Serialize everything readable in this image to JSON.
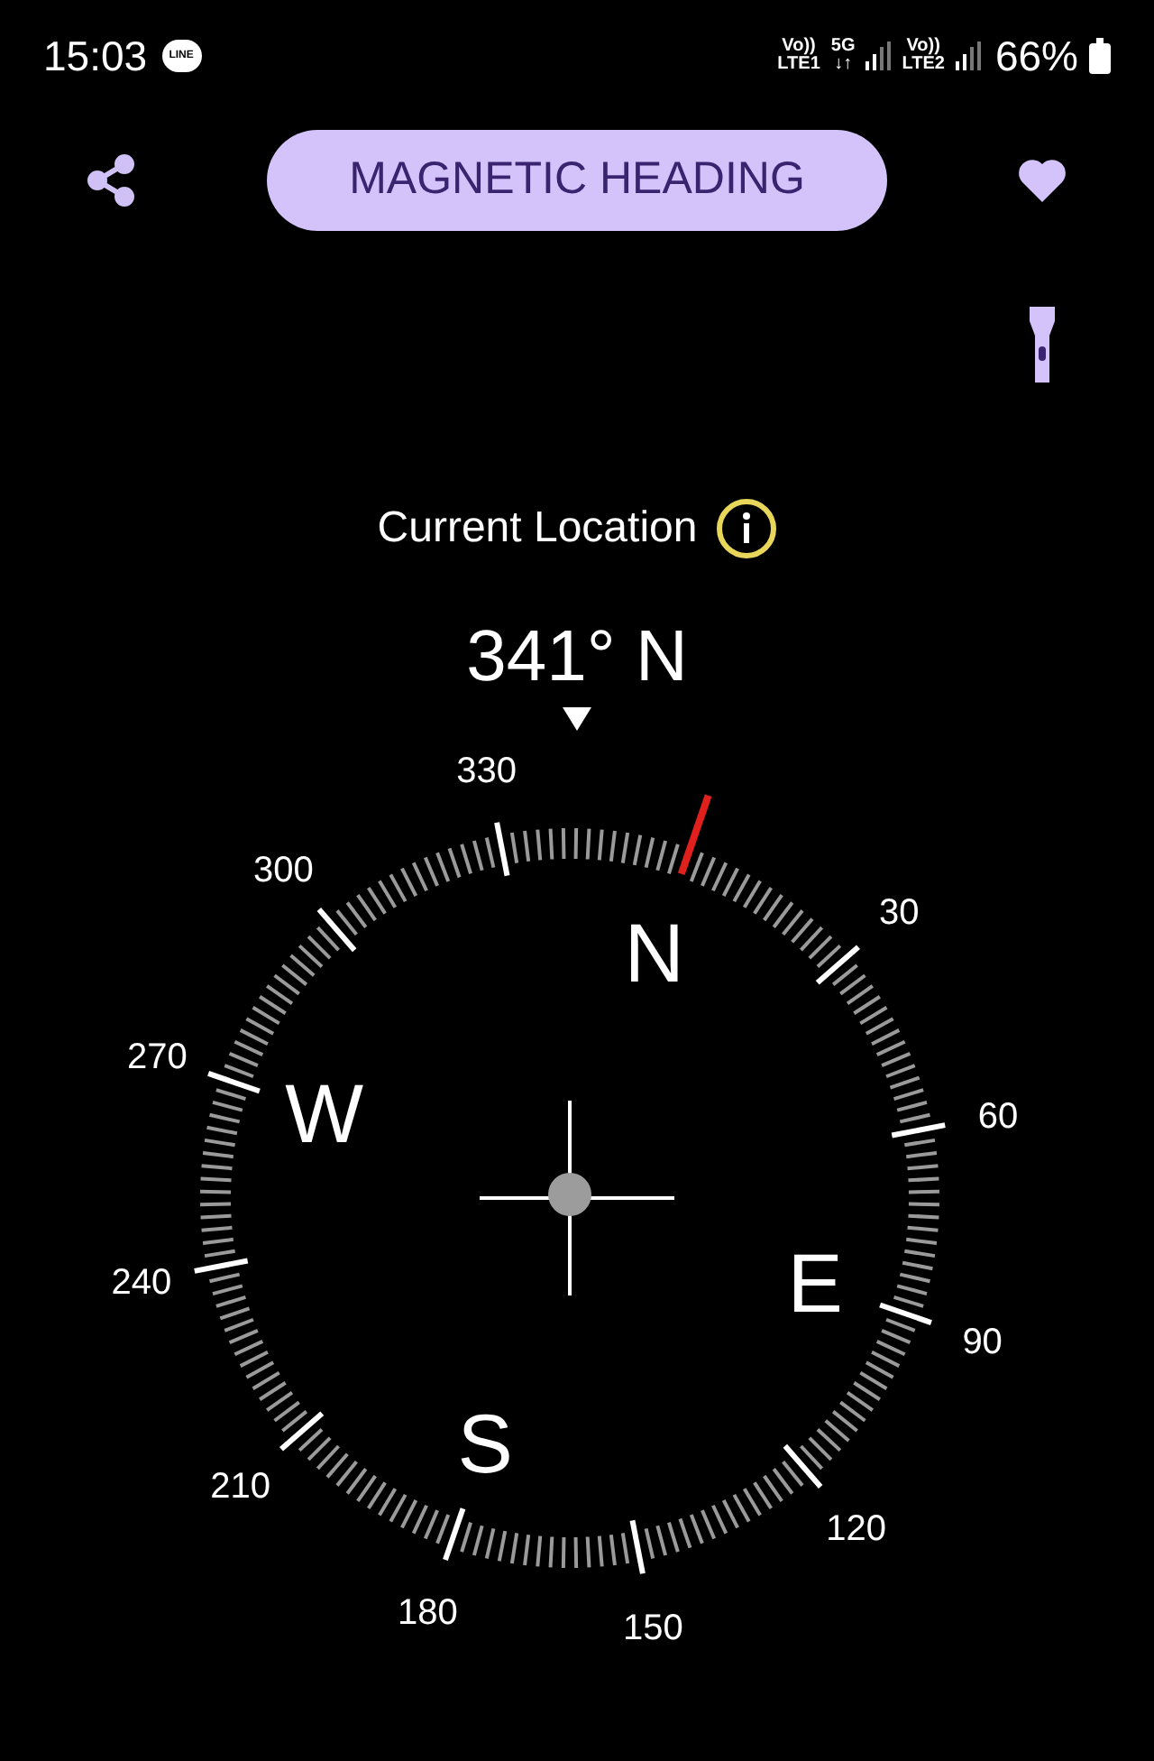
{
  "status_bar": {
    "time": "15:03",
    "notification_app": "LINE",
    "sim1_top": "Vo))",
    "sim1_bottom": "LTE1",
    "network_top": "5G",
    "network_bottom": "↓↑",
    "sim2_top": "Vo))",
    "sim2_bottom": "LTE2",
    "battery": "66%"
  },
  "toolbar": {
    "mode_button": "MAGNETIC HEADING"
  },
  "location": {
    "label": "Current Location"
  },
  "heading": "341° N",
  "compass": {
    "degree_labels": [
      "30",
      "60",
      "90",
      "120",
      "150",
      "180",
      "210",
      "240",
      "270",
      "300",
      "330"
    ],
    "cardinals": [
      {
        "label": "N",
        "kind": "north"
      },
      {
        "label": "E",
        "kind": "east"
      },
      {
        "label": "S",
        "kind": "south"
      },
      {
        "label": "W",
        "kind": "west"
      }
    ]
  }
}
